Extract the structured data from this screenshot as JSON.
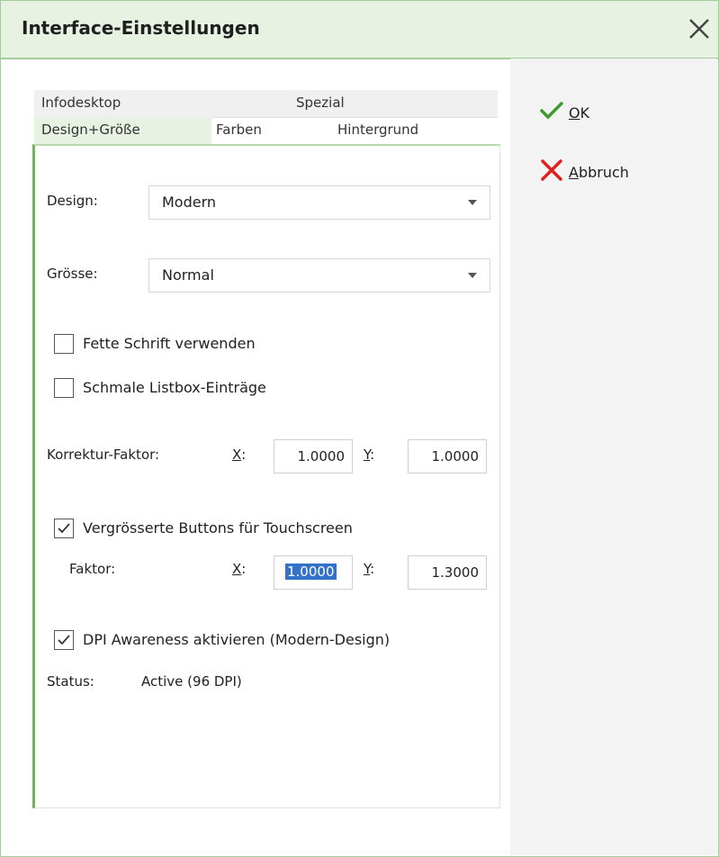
{
  "window": {
    "title": "Interface-Einstellungen"
  },
  "actions": {
    "ok_prefix": "",
    "ok_mnemonic": "O",
    "ok_rest": "K",
    "cancel_mnemonic": "A",
    "cancel_rest": "bbruch"
  },
  "tabs": {
    "row1": [
      "Infodesktop",
      "Spezial"
    ],
    "row2": [
      "Design+Größe",
      "Farben",
      "Hintergrund"
    ],
    "active": "Design+Größe"
  },
  "design": {
    "design_label": "Design:",
    "design_value": "Modern",
    "size_label": "Grösse:",
    "size_value": "Normal"
  },
  "options": {
    "bold_font": {
      "label": "Fette Schrift verwenden",
      "checked": false
    },
    "narrow_listbox": {
      "label": "Schmale Listbox-Einträge",
      "checked": false
    }
  },
  "correction": {
    "label": "Korrektur-Faktor:",
    "x_mnemonic": "X",
    "y_mnemonic": "Y",
    "colon": ":",
    "x_value": "1.0000",
    "y_value": "1.0000"
  },
  "touch": {
    "label": "Vergrösserte Buttons für Touchscreen",
    "checked": true,
    "factor_label": "Faktor:",
    "x_value": "1.0000",
    "y_value": "1.3000"
  },
  "dpi": {
    "label": "DPI Awareness aktivieren (Modern-Design)",
    "checked": true,
    "status_label": "Status:",
    "status_value": "Active (96 DPI)"
  },
  "colors": {
    "accent": "#6fb35f",
    "ok_check": "#3c9a2f",
    "cancel_x": "#e02020",
    "selection": "#3471c9"
  }
}
